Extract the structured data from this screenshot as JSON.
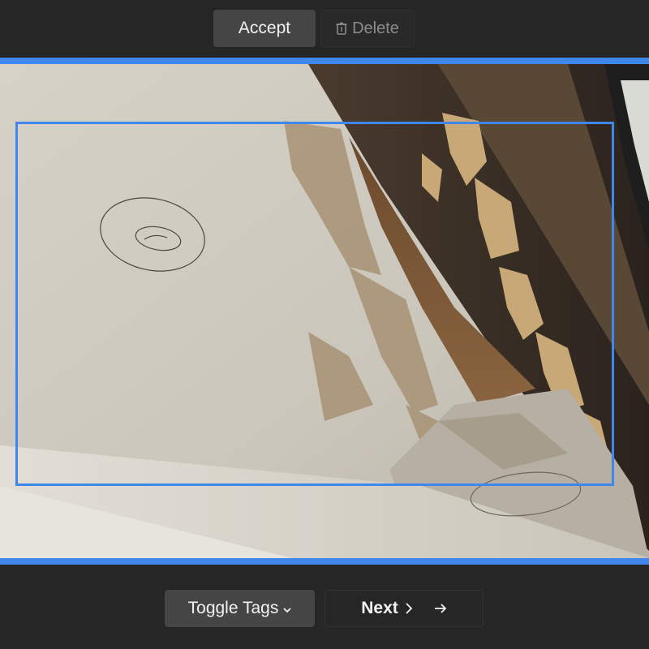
{
  "toolbar": {
    "accept_label": "Accept",
    "delete_label": "Delete",
    "delete_icon": "trash-icon"
  },
  "viewer": {
    "frame_color": "#3f87ea",
    "bbox_color": "#3f87ea",
    "subject": "peeling ceiling paint photo"
  },
  "footer": {
    "toggle_tags_label": "Toggle Tags",
    "toggle_icon": "chevron-down-icon",
    "next_label": "Next",
    "next_chevron_icon": "chevron-right-icon",
    "next_arrow_icon": "arrow-right-icon"
  }
}
